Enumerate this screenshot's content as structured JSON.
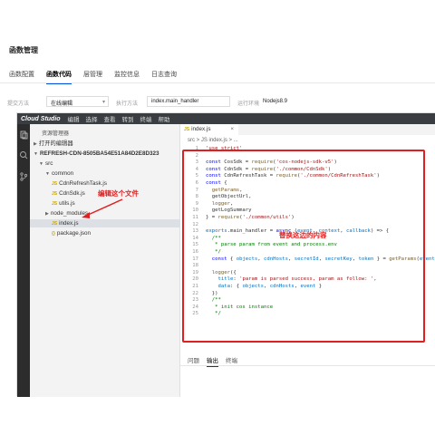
{
  "page_title": "函数管理",
  "tabs": [
    {
      "label": "函数配置",
      "active": false
    },
    {
      "label": "函数代码",
      "active": true
    },
    {
      "label": "层管理",
      "active": false
    },
    {
      "label": "监控信息",
      "active": false
    },
    {
      "label": "日志查询",
      "active": false
    }
  ],
  "form": {
    "submit_method_label": "提交方法",
    "submit_method_value": "在线编辑",
    "exec_method_label": "执行方法",
    "exec_method_value": "index.main_handler",
    "runtime_label": "运行环境",
    "runtime_value": "Nodejs8.9"
  },
  "ide": {
    "logo": "Cloud Studio",
    "menu": [
      "编辑",
      "选择",
      "查看",
      "转到",
      "终端",
      "帮助"
    ],
    "sidebar_title": "资源管理器",
    "open_editors": "打开的编辑器",
    "project": "REFRESH-CDN-8505BA54E51A84D2E8D323",
    "tree": [
      {
        "label": "src",
        "kind": "folder"
      },
      {
        "label": "common",
        "kind": "folder"
      },
      {
        "label": "CdnRefreshTask.js",
        "kind": "js"
      },
      {
        "label": "CdnSdk.js",
        "kind": "js"
      },
      {
        "label": "utils.js",
        "kind": "js"
      },
      {
        "label": "node_modules",
        "kind": "folder"
      },
      {
        "label": "index.js",
        "kind": "js"
      },
      {
        "label": "package.json",
        "kind": "json"
      }
    ],
    "editor_tab": "index.js",
    "breadcrumb": "src > JS index.js > ...",
    "panel_tabs": [
      "问题",
      "输出",
      "终端"
    ]
  },
  "code_lines": [
    {
      "n": "1",
      "t": "'use strict'"
    },
    {
      "n": "2",
      "t": ""
    },
    {
      "n": "3",
      "t": "const CosSdk = require('cos-nodejs-sdk-v5')"
    },
    {
      "n": "4",
      "t": "const CdnSdk = require('./common/CdnSdk')"
    },
    {
      "n": "5",
      "t": "const CdnRefreshTask = require('./common/CdnRefreshTask')"
    },
    {
      "n": "6",
      "t": "const {"
    },
    {
      "n": "7",
      "t": "  getParams,"
    },
    {
      "n": "8",
      "t": "  getObjectUrl,"
    },
    {
      "n": "9",
      "t": "  logger,"
    },
    {
      "n": "10",
      "t": "  getLogSummary"
    },
    {
      "n": "11",
      "t": "} = require('./common/utils')"
    },
    {
      "n": "12",
      "t": ""
    },
    {
      "n": "13",
      "t": "exports.main_handler = async (event, context, callback) => {"
    },
    {
      "n": "14",
      "t": "  /**"
    },
    {
      "n": "15",
      "t": "   * parse param from event and process.env"
    },
    {
      "n": "16",
      "t": "   */"
    },
    {
      "n": "17",
      "t": "  const { objects, cdnHosts, secretId, secretKey, token } = getParams(event)"
    },
    {
      "n": "18",
      "t": ""
    },
    {
      "n": "19",
      "t": "  logger({"
    },
    {
      "n": "20",
      "t": "    title: 'param is parsed success, param as follow: ',"
    },
    {
      "n": "21",
      "t": "    data: { objects, cdnHosts, event }"
    },
    {
      "n": "22",
      "t": "  })"
    },
    {
      "n": "23",
      "t": "  /**"
    },
    {
      "n": "24",
      "t": "   * init cos instance"
    },
    {
      "n": "25",
      "t": "   */"
    }
  ],
  "annotations": {
    "edit_file": "编辑这个文件",
    "replace_content": "替换这边的内容"
  },
  "colors": {
    "accent": "#0052d9",
    "annotation": "#e02020"
  }
}
